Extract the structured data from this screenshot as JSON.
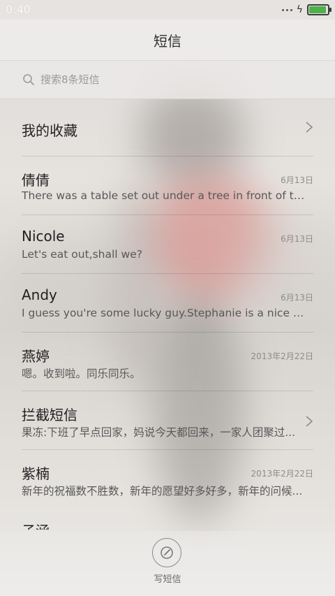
{
  "status_bar": {
    "time": "0:40"
  },
  "header": {
    "title": "短信"
  },
  "search": {
    "placeholder": "搜索8条短信"
  },
  "favorites": {
    "label": "我的收藏"
  },
  "conversations": [
    {
      "name": "倩倩",
      "date": "6月13日",
      "preview": "There was a table set out under a tree in front of the ho..."
    },
    {
      "name": "Nicole",
      "date": "6月13日",
      "preview": "Let's eat out,shall we?"
    },
    {
      "name": "Andy",
      "date": "6月13日",
      "preview": "I guess you're some lucky guy.Stephanie is a nice girl."
    },
    {
      "name": "燕婷",
      "date": "2013年2月22日",
      "preview": "嗯。收到啦。同乐同乐。"
    },
    {
      "name": "拦截短信",
      "date": "",
      "preview": "果冻:下班了早点回家，妈说今天都回来，一家人团聚过..."
    },
    {
      "name": "紫楠",
      "date": "2013年2月22日",
      "preview": "新年的祝福数不胜数，新年的愿望好多好多，新年的问候..."
    }
  ],
  "partially_visible": {
    "name": "子涵"
  },
  "compose": {
    "label": "写短信"
  },
  "colors": {
    "battery": "#4cb34a"
  }
}
